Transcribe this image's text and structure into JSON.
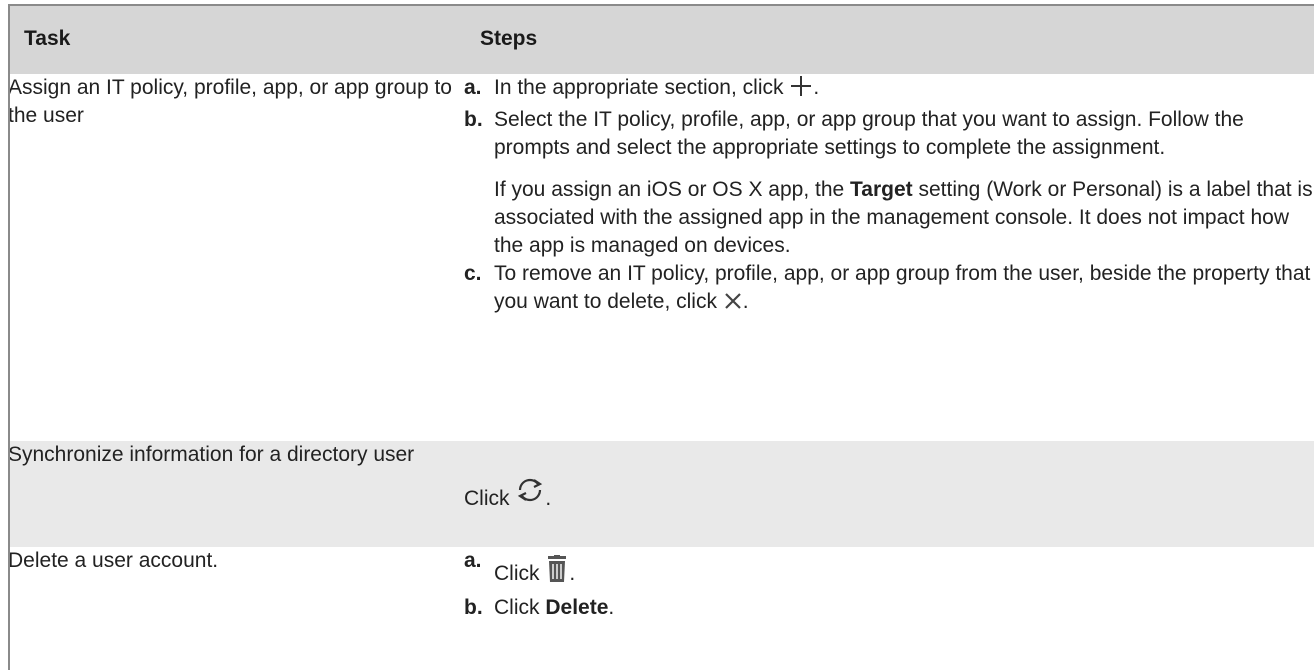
{
  "table": {
    "headers": {
      "task": "Task",
      "steps": "Steps"
    },
    "row1": {
      "task": "Assign an IT policy, profile, app, or app group to the user",
      "step_a_marker": "a.",
      "step_a_text": "In the appropriate section, click",
      "step_a_icon": "plus-icon",
      "step_a_end": ".",
      "step_b_marker": "b.",
      "step_b_text": "Select the IT policy, profile, app, or app group that you want to assign. Follow the prompts and select the appropriate settings to complete the assignment.",
      "note_before": "If you assign an iOS or OS X app, the ",
      "note_term": "Target",
      "note_after": " setting (Work or Personal) is a label that is associated with the assigned app in the management console. It does not impact how the app is managed on devices.",
      "step_c_marker": "c.",
      "step_c_text": "To remove an IT policy, profile, app, or app group from the user, beside the property that you want to delete, click",
      "step_c_icon": "close-x-icon",
      "step_c_end": "."
    },
    "row2": {
      "task": "Synchronize information for a directory user",
      "steps_text": "Click",
      "steps_icon": "sync-icon",
      "steps_end": "."
    },
    "row3": {
      "task": "Delete a user account.",
      "step_a_marker": "a.",
      "step_a_text": "Click",
      "step_a_icon": "trash-icon",
      "step_a_end": ".",
      "step_b_marker": "b.",
      "step_b_text": "Click ",
      "step_b_term": "Delete",
      "step_b_end": "."
    }
  },
  "colors": {
    "header_bg": "#d6d6d6",
    "row_grey_bg": "#e9e9e9",
    "text": "#222222",
    "border": "#8a8a8a"
  }
}
